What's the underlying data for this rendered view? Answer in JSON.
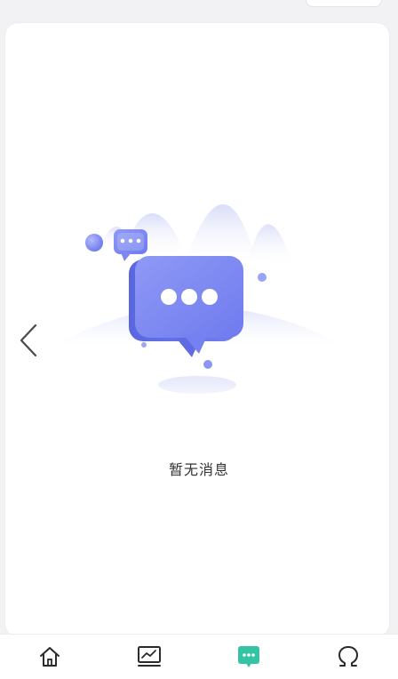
{
  "empty_state": {
    "message": "暂无消息",
    "illustration": "chat-bubble-empty-illustration"
  },
  "navigation": {
    "back_icon": "chevron-left-icon"
  },
  "tabbar": {
    "items": [
      {
        "icon": "home-icon",
        "active": false
      },
      {
        "icon": "chart-icon",
        "active": false
      },
      {
        "icon": "message-icon",
        "active": true
      },
      {
        "icon": "profile-icon",
        "active": false
      }
    ],
    "active_color": "#35c3a4",
    "inactive_color": "#2b2b2b"
  },
  "colors": {
    "bubble_blue": "#7b86f2",
    "mountain_tint": "#e7e9fb"
  }
}
